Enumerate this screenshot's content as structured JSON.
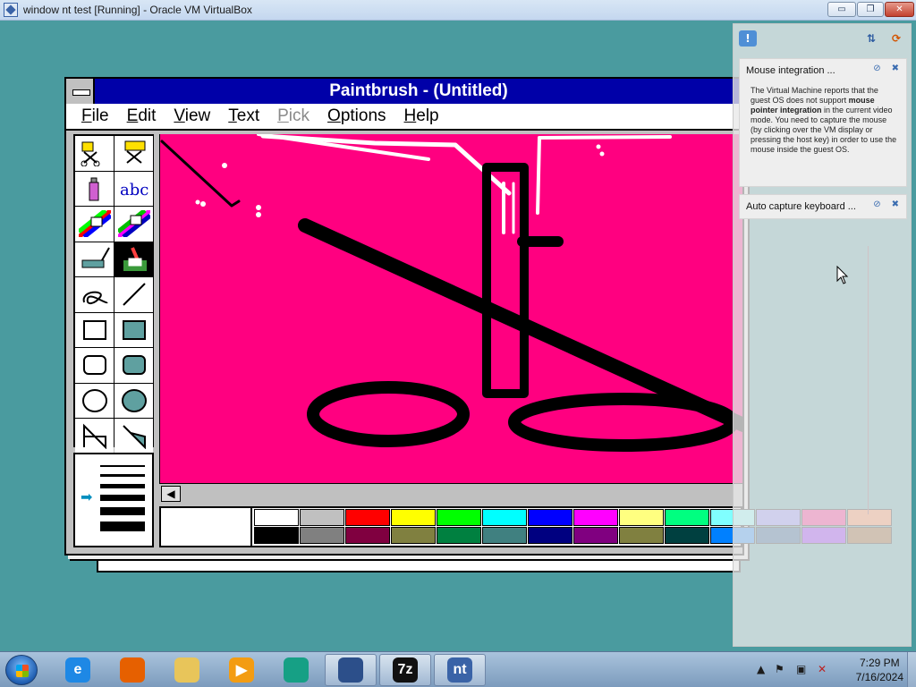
{
  "host": {
    "title": "window nt test [Running] - Oracle VM VirtualBox",
    "controls": {
      "minimize": "▭",
      "maximize": "❐",
      "close": "✕"
    }
  },
  "paintbrush": {
    "title": "Paintbrush - (Untitled)",
    "menus": [
      {
        "label": "File",
        "accel": "F",
        "rest": "ile",
        "enabled": true
      },
      {
        "label": "Edit",
        "accel": "E",
        "rest": "dit",
        "enabled": true
      },
      {
        "label": "View",
        "accel": "V",
        "rest": "iew",
        "enabled": true
      },
      {
        "label": "Text",
        "accel": "T",
        "rest": "ext",
        "enabled": true
      },
      {
        "label": "Pick",
        "accel": "P",
        "rest": "ick",
        "enabled": false
      },
      {
        "label": "Options",
        "accel": "O",
        "rest": "ptions",
        "enabled": true
      },
      {
        "label": "Help",
        "accel": "H",
        "rest": "elp",
        "enabled": true
      }
    ],
    "tools": [
      {
        "name": "scissors-icon"
      },
      {
        "name": "pick-scissors-icon"
      },
      {
        "name": "airbrush-icon"
      },
      {
        "name": "text-tool-icon",
        "label": "abc"
      },
      {
        "name": "color-eraser-icon"
      },
      {
        "name": "eraser-icon"
      },
      {
        "name": "paint-roller-icon"
      },
      {
        "name": "brush-icon",
        "selected": true
      },
      {
        "name": "curve-icon"
      },
      {
        "name": "line-icon"
      },
      {
        "name": "box-icon"
      },
      {
        "name": "filled-box-icon"
      },
      {
        "name": "rounded-box-icon"
      },
      {
        "name": "filled-rounded-box-icon"
      },
      {
        "name": "circle-icon"
      },
      {
        "name": "filled-circle-icon"
      },
      {
        "name": "polygon-icon"
      },
      {
        "name": "filled-polygon-icon"
      }
    ],
    "line_widths_selected_index": 1,
    "canvas_background": "#ff0080",
    "palette": {
      "foreground": "#000000",
      "background": "#ffffff",
      "colors": [
        "#ffffff",
        "#c0c0c0",
        "#ff0000",
        "#ffff00",
        "#00ff00",
        "#00ffff",
        "#0000ff",
        "#ff00ff",
        "#ffff80",
        "#00ff80",
        "#80ffff",
        "#8080ff",
        "#ff0080",
        "#ff8040",
        "#000000",
        "#808080",
        "#800040",
        "#808040",
        "#008040",
        "#408080",
        "#000080",
        "#800080",
        "#808040",
        "#004040",
        "#0080ff",
        "#004080",
        "#8000ff",
        "#804000"
      ]
    }
  },
  "notifications": [
    {
      "title": "Mouse integration ...",
      "body_parts": [
        "The Virtual Machine reports that the guest OS does not support ",
        "mouse pointer integration",
        " in the current video mode. You need to capture the mouse (by clicking over the VM display or pressing the host key) in order to use the mouse inside the guest OS."
      ]
    },
    {
      "title": "Auto capture keyboard ..."
    }
  ],
  "taskbar": {
    "items": [
      {
        "name": "internet-explorer-icon",
        "glyph": "e",
        "color": "#1e88e5",
        "active": false
      },
      {
        "name": "firefox-icon",
        "glyph": "",
        "color": "#e66000",
        "active": false
      },
      {
        "name": "file-explorer-icon",
        "glyph": "",
        "color": "#e8c55a",
        "active": false
      },
      {
        "name": "media-player-icon",
        "glyph": "▶",
        "color": "#f39c12",
        "active": false
      },
      {
        "name": "app-icon",
        "glyph": "",
        "color": "#16a085",
        "active": false
      },
      {
        "name": "virtualbox-icon",
        "glyph": "",
        "color": "#2c4f8a",
        "active": true
      },
      {
        "name": "7zip-icon",
        "glyph": "7z",
        "color": "#111111",
        "active": true
      },
      {
        "name": "windows-nt-vm-icon",
        "glyph": "nt",
        "color": "#3a63a7",
        "active": true
      }
    ],
    "clock_time": "7:29 PM",
    "clock_date": "7/16/2024"
  }
}
